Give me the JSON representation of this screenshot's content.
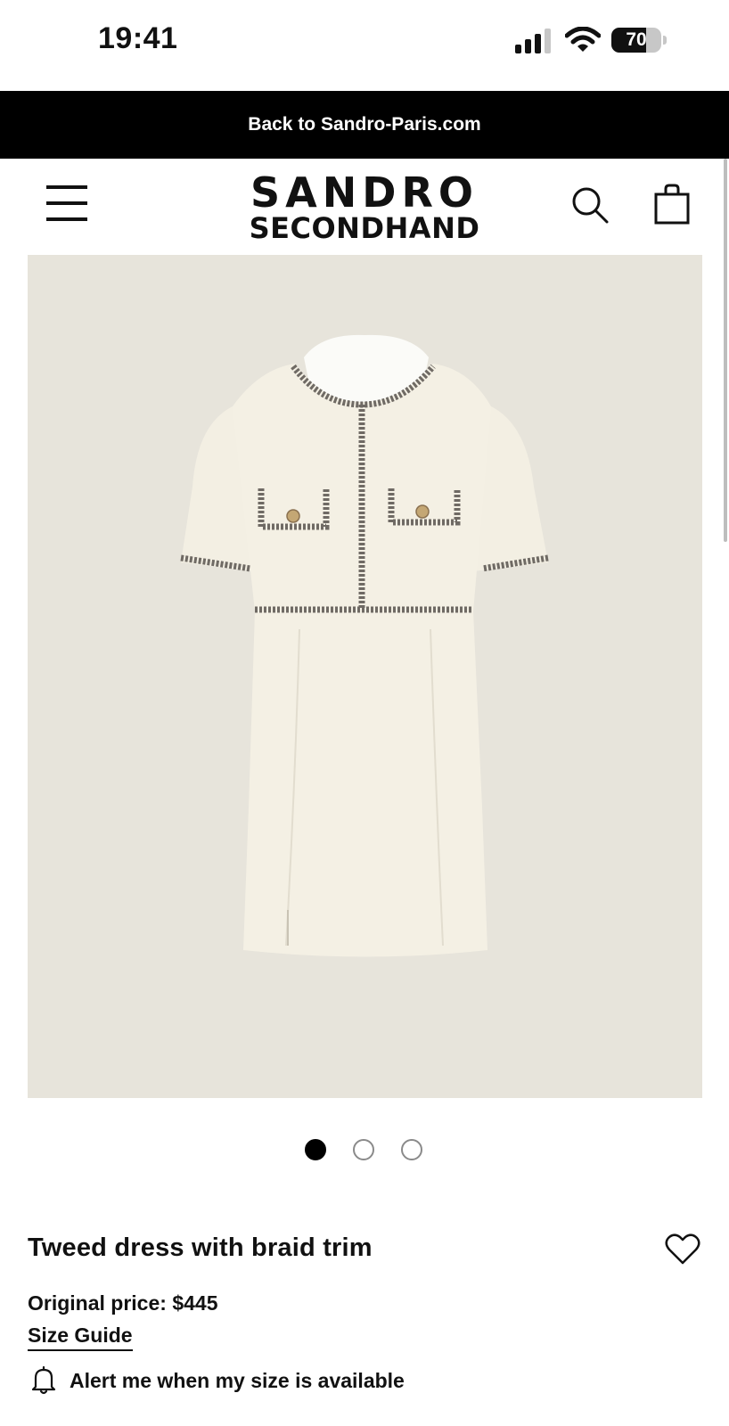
{
  "status_bar": {
    "time": "19:41",
    "battery_level": "70",
    "battery_fraction": 0.7,
    "signal_icon": "cellular-signal-icon",
    "wifi_icon": "wifi-icon"
  },
  "promo_bar": {
    "label": "Back to Sandro-Paris.com"
  },
  "header": {
    "logo_line1": "SANDRO",
    "logo_line2": "SECONDHAND",
    "menu_icon": "hamburger-menu-icon",
    "search_icon": "search-icon",
    "bag_icon": "shopping-bag-icon"
  },
  "gallery": {
    "image_subject": "cream tweed dress with braid trim",
    "background_color": "#e7e4db",
    "image_count": 3,
    "active_index": 0
  },
  "product": {
    "title": "Tweed dress with braid trim",
    "price_line": "Original price: $445",
    "size_guide_label": "Size Guide",
    "alert_label": "Alert me when my size is available",
    "wishlist_icon": "heart-icon",
    "alert_icon": "bell-icon"
  }
}
